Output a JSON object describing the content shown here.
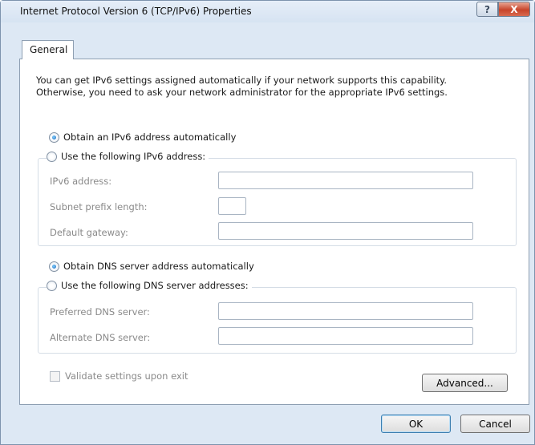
{
  "window": {
    "title": "Internet Protocol Version 6 (TCP/IPv6) Properties",
    "help_symbol": "?",
    "close_symbol": "X"
  },
  "tabs": [
    {
      "label": "General"
    }
  ],
  "intro": {
    "line1": "You can get IPv6 settings assigned automatically if your network supports this capability.",
    "line2": "Otherwise, you need to ask your network administrator for the appropriate IPv6 settings."
  },
  "ip": {
    "auto_label": "Obtain an IPv6 address automatically",
    "auto_selected": true,
    "manual_label": "Use the following IPv6 address:",
    "fields": {
      "address_label": "IPv6 address:",
      "address_value": "",
      "prefix_label": "Subnet prefix length:",
      "prefix_value": "",
      "gateway_label": "Default gateway:",
      "gateway_value": ""
    }
  },
  "dns": {
    "auto_label": "Obtain DNS server address automatically",
    "auto_selected": true,
    "manual_label": "Use the following DNS server addresses:",
    "fields": {
      "preferred_label": "Preferred DNS server:",
      "preferred_value": "",
      "alternate_label": "Alternate DNS server:",
      "alternate_value": ""
    }
  },
  "validate_label": "Validate settings upon exit",
  "buttons": {
    "advanced": "Advanced...",
    "ok": "OK",
    "cancel": "Cancel"
  }
}
